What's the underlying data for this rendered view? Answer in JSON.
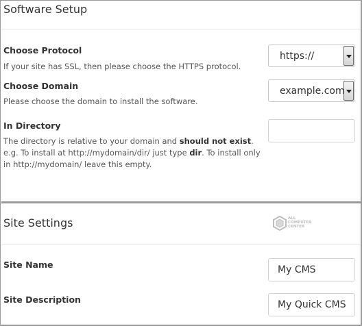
{
  "software_setup": {
    "title": "Software Setup",
    "protocol": {
      "label": "Choose Protocol",
      "help": "If your site has SSL, then please choose the HTTPS protocol.",
      "selected": "https://"
    },
    "domain": {
      "label": "Choose Domain",
      "help": "Please choose the domain to install the software.",
      "selected": "example.com"
    },
    "directory": {
      "label": "In Directory",
      "help_part1": "The directory is relative to your domain and ",
      "help_bold1": "should not exist",
      "help_part2": ". e.g. To install at http://mydomain/dir/ just type ",
      "help_bold2": "dir",
      "help_part3": ". To install only in http://mydomain/ leave this empty.",
      "value": ""
    }
  },
  "site_settings": {
    "title": "Site Settings",
    "logo_text": [
      "ALL",
      "COMPUTER",
      "CENTER"
    ],
    "site_name": {
      "label": "Site Name",
      "value": "My CMS"
    },
    "site_description": {
      "label": "Site Description",
      "value": "My Quick CMS"
    }
  },
  "icons": {
    "select_arrow": "chevron-down-icon",
    "logo": "hexagon-logo-icon"
  }
}
